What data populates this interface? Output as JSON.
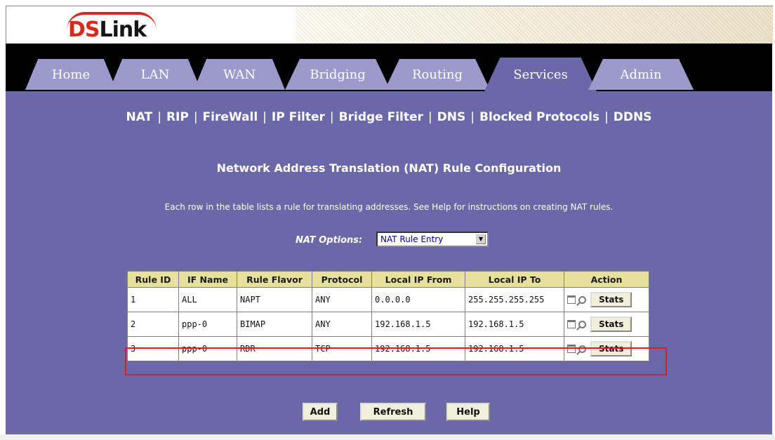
{
  "brand": {
    "logo_text_1": "DS",
    "logo_text_2": "Link"
  },
  "tabs": [
    {
      "label": "Home"
    },
    {
      "label": "LAN"
    },
    {
      "label": "WAN"
    },
    {
      "label": "Bridging"
    },
    {
      "label": "Routing"
    },
    {
      "label": "Services",
      "active": true
    },
    {
      "label": "Admin"
    }
  ],
  "submenu": [
    "NAT",
    "RIP",
    "FireWall",
    "IP Filter",
    "Bridge Filter",
    "DNS",
    "Blocked Protocols",
    "DDNS"
  ],
  "page": {
    "title": "Network Address Translation (NAT) Rule Configuration",
    "description": "Each row in the table lists a rule for translating addresses. See Help for instructions on creating NAT rules."
  },
  "nat_options": {
    "label": "NAT Options:",
    "selected": "NAT Rule Entry"
  },
  "table": {
    "headers": [
      "Rule ID",
      "IF Name",
      "Rule Flavor",
      "Protocol",
      "Local IP From",
      "Local IP To",
      "Action"
    ],
    "rows": [
      [
        "1",
        "ALL",
        "NAPT",
        "ANY",
        "0.0.0.0",
        "255.255.255.255"
      ],
      [
        "2",
        "ppp-0",
        "BIMAP",
        "ANY",
        "192.168.1.5",
        "192.168.1.5"
      ],
      [
        "3",
        "ppp-0",
        "RDR",
        "TCP",
        "192.168.1.5",
        "192.168.1.5"
      ]
    ],
    "action_label": "Stats"
  },
  "buttons": {
    "add": "Add",
    "refresh": "Refresh",
    "help": "Help"
  },
  "colors": {
    "content_bg": "#6a68a6",
    "tab_bg": "#9c9acb",
    "header_row": "#e6df9e",
    "highlight": "#e21b1b"
  }
}
